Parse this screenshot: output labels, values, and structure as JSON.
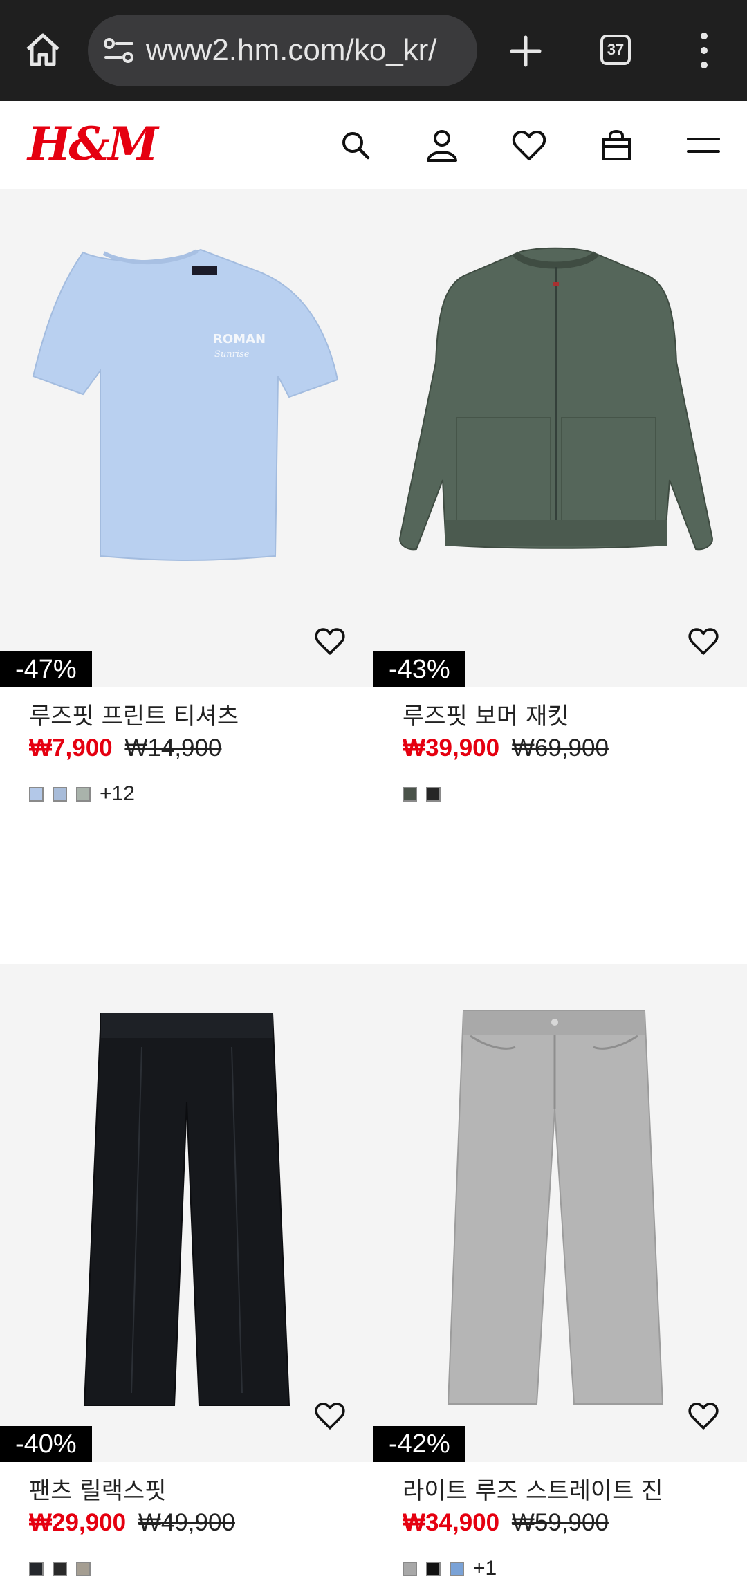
{
  "browser": {
    "url": "www2.hm.com/ko_kr/",
    "tab_count": "37"
  },
  "site": {
    "logo": "H&M"
  },
  "products": [
    {
      "name": "루즈핏 프린트 티셔츠",
      "sale_price": "₩7,900",
      "original_price": "₩14,900",
      "discount": "-47%",
      "swatches": [
        "#b3c8e8",
        "#a8bcd9",
        "#a9b3ab"
      ],
      "more_colors": "+12"
    },
    {
      "name": "루즈핏 보머 재킷",
      "sale_price": "₩39,900",
      "original_price": "₩69,900",
      "discount": "-43%",
      "swatches": [
        "#4a5249",
        "#262626"
      ],
      "more_colors": ""
    },
    {
      "name": "팬츠 릴랙스핏",
      "sale_price": "₩29,900",
      "original_price": "₩49,900",
      "discount": "-40%",
      "swatches": [
        "#25282d",
        "#2a2a2a",
        "#a59e92"
      ],
      "more_colors": ""
    },
    {
      "name": "라이트 루즈 스트레이트 진",
      "sale_price": "₩34,900",
      "original_price": "₩59,900",
      "discount": "-42%",
      "swatches": [
        "#a8a8a8",
        "#111111",
        "#7aa2d6"
      ],
      "more_colors": "+1"
    }
  ],
  "colors": {
    "brand_red": "#e50010",
    "chrome_bg": "#1f1f1f",
    "photo_bg": "#f4f4f4"
  }
}
